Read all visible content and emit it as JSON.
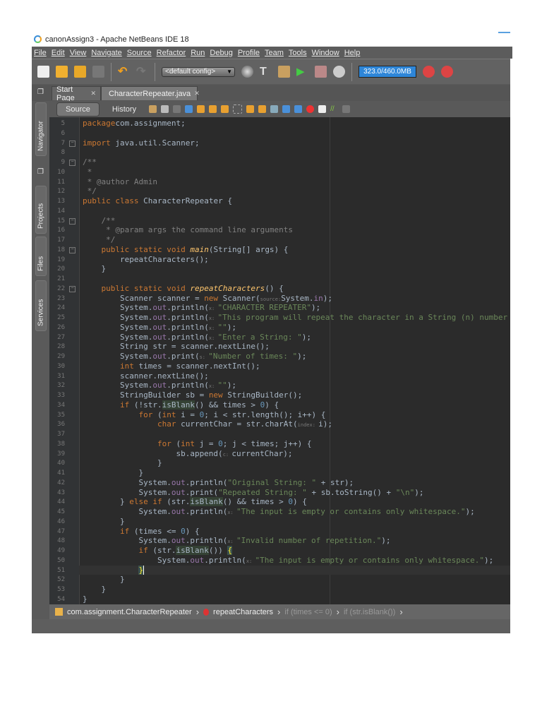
{
  "window": {
    "title": "canonAssign3 - Apache NetBeans IDE 18"
  },
  "menu": [
    "File",
    "Edit",
    "View",
    "Navigate",
    "Source",
    "Refactor",
    "Run",
    "Debug",
    "Profile",
    "Team",
    "Tools",
    "Window",
    "Help"
  ],
  "toolbar": {
    "config": "<default config>",
    "memory": "323.0/460.0MB"
  },
  "tabs": [
    {
      "label": "Start Page"
    },
    {
      "label": "CharacterRepeater.java"
    }
  ],
  "editor_tabs": {
    "source": "Source",
    "history": "History"
  },
  "side_panels": [
    "Navigator",
    "Projects",
    "Files",
    "Services"
  ],
  "breadcrumb": [
    "com.assignment.CharacterRepeater",
    "repeatCharacters",
    "if (times <= 0)",
    "if (str.isBlank())"
  ],
  "code": [
    {
      "n": 5,
      "t": [
        [
          "kw",
          "package"
        ],
        [
          "",
          "com.assignment;"
        ]
      ]
    },
    {
      "n": 6,
      "t": []
    },
    {
      "n": 7,
      "fold": true,
      "t": [
        [
          "kw",
          "import"
        ],
        [
          "",
          " java.util.Scanner;"
        ]
      ]
    },
    {
      "n": 8,
      "t": []
    },
    {
      "n": 9,
      "fold": true,
      "t": [
        [
          "cmt",
          "/**"
        ]
      ]
    },
    {
      "n": 10,
      "t": [
        [
          "cmt",
          " *"
        ]
      ]
    },
    {
      "n": 11,
      "t": [
        [
          "cmt",
          " * @author Admin"
        ]
      ]
    },
    {
      "n": 12,
      "t": [
        [
          "cmt",
          " */"
        ]
      ]
    },
    {
      "n": 13,
      "t": [
        [
          "kw",
          "public class"
        ],
        [
          "",
          " CharacterRepeater {"
        ]
      ]
    },
    {
      "n": 14,
      "t": []
    },
    {
      "n": 15,
      "fold": true,
      "t": [
        [
          "",
          "    "
        ],
        [
          "cmt",
          "/**"
        ]
      ]
    },
    {
      "n": 16,
      "t": [
        [
          "",
          "    "
        ],
        [
          "cmt",
          " * @param args the command line arguments"
        ]
      ]
    },
    {
      "n": 17,
      "t": [
        [
          "",
          "    "
        ],
        [
          "cmt",
          " */"
        ]
      ]
    },
    {
      "n": 18,
      "fold": true,
      "t": [
        [
          "",
          "    "
        ],
        [
          "kw",
          "public static void"
        ],
        [
          "",
          " "
        ],
        [
          "mth",
          "main"
        ],
        [
          "",
          "(String[] args) {"
        ]
      ]
    },
    {
      "n": 19,
      "t": [
        [
          "",
          "        repeatCharacters();"
        ]
      ]
    },
    {
      "n": 20,
      "t": [
        [
          "",
          "    }"
        ]
      ]
    },
    {
      "n": 21,
      "t": []
    },
    {
      "n": 22,
      "fold": true,
      "t": [
        [
          "",
          "    "
        ],
        [
          "kw",
          "public static void"
        ],
        [
          "",
          " "
        ],
        [
          "mth",
          "repeatCharacters"
        ],
        [
          "",
          "() {"
        ]
      ]
    },
    {
      "n": 23,
      "t": [
        [
          "",
          "        Scanner scanner = "
        ],
        [
          "kw",
          "new"
        ],
        [
          "",
          " Scanner("
        ],
        [
          "hint",
          "source:"
        ],
        [
          "",
          "System."
        ],
        [
          "fld",
          "in"
        ],
        [
          "",
          ");"
        ]
      ]
    },
    {
      "n": 24,
      "t": [
        [
          "",
          "        System."
        ],
        [
          "fld",
          "out"
        ],
        [
          "",
          ".println("
        ],
        [
          "hint",
          "x: "
        ],
        [
          "str",
          "\"CHARACTER REPEATER\""
        ],
        [
          "",
          ");"
        ]
      ]
    },
    {
      "n": 25,
      "t": [
        [
          "",
          "        System."
        ],
        [
          "fld",
          "out"
        ],
        [
          "",
          ".println("
        ],
        [
          "hint",
          "x: "
        ],
        [
          "str",
          "\"This program will repeat the character in a String (n) number of times.\""
        ],
        [
          "",
          ");"
        ]
      ]
    },
    {
      "n": 26,
      "t": [
        [
          "",
          "        System."
        ],
        [
          "fld",
          "out"
        ],
        [
          "",
          ".println("
        ],
        [
          "hint",
          "x: "
        ],
        [
          "str",
          "\"\""
        ],
        [
          "",
          ");"
        ]
      ]
    },
    {
      "n": 27,
      "t": [
        [
          "",
          "        System."
        ],
        [
          "fld",
          "out"
        ],
        [
          "",
          ".println("
        ],
        [
          "hint",
          "x: "
        ],
        [
          "str",
          "\"Enter a String: \""
        ],
        [
          "",
          ");"
        ]
      ]
    },
    {
      "n": 28,
      "t": [
        [
          "",
          "        String str = scanner.nextLine();"
        ]
      ]
    },
    {
      "n": 29,
      "t": [
        [
          "",
          "        System."
        ],
        [
          "fld",
          "out"
        ],
        [
          "",
          ".print("
        ],
        [
          "hint",
          "s: "
        ],
        [
          "str",
          "\"Number of times: \""
        ],
        [
          "",
          ");"
        ]
      ]
    },
    {
      "n": 30,
      "t": [
        [
          "",
          "        "
        ],
        [
          "kw",
          "int"
        ],
        [
          "",
          " times = scanner.nextInt();"
        ]
      ]
    },
    {
      "n": 31,
      "t": [
        [
          "",
          "        scanner.nextLine();"
        ]
      ]
    },
    {
      "n": 32,
      "t": [
        [
          "",
          "        System."
        ],
        [
          "fld",
          "out"
        ],
        [
          "",
          ".println("
        ],
        [
          "hint",
          "x: "
        ],
        [
          "str",
          "\"\""
        ],
        [
          "",
          ");"
        ]
      ]
    },
    {
      "n": 33,
      "t": [
        [
          "",
          "        StringBuilder sb = "
        ],
        [
          "kw",
          "new"
        ],
        [
          "",
          " StringBuilder();"
        ]
      ]
    },
    {
      "n": 34,
      "t": [
        [
          "",
          "        "
        ],
        [
          "kw",
          "if"
        ],
        [
          "",
          " (!str."
        ],
        [
          "hl",
          "isBlank"
        ],
        [
          "",
          "() && times > "
        ],
        [
          "num",
          "0"
        ],
        [
          "",
          ") {"
        ]
      ]
    },
    {
      "n": 35,
      "t": [
        [
          "",
          "            "
        ],
        [
          "kw",
          "for"
        ],
        [
          "",
          " ("
        ],
        [
          "kw",
          "int"
        ],
        [
          "",
          " i = "
        ],
        [
          "num",
          "0"
        ],
        [
          "",
          "; i < str.length(); i++) {"
        ]
      ]
    },
    {
      "n": 36,
      "t": [
        [
          "",
          "                "
        ],
        [
          "kw",
          "char"
        ],
        [
          "",
          " currentChar = str.charAt("
        ],
        [
          "hint",
          "index: "
        ],
        [
          "",
          "i);"
        ]
      ]
    },
    {
      "n": 37,
      "t": []
    },
    {
      "n": 38,
      "t": [
        [
          "",
          "                "
        ],
        [
          "kw",
          "for"
        ],
        [
          "",
          " ("
        ],
        [
          "kw",
          "int"
        ],
        [
          "",
          " j = "
        ],
        [
          "num",
          "0"
        ],
        [
          "",
          "; j < times; j++) {"
        ]
      ]
    },
    {
      "n": 39,
      "t": [
        [
          "",
          "                    sb.append("
        ],
        [
          "hint",
          "c: "
        ],
        [
          "",
          "currentChar);"
        ]
      ]
    },
    {
      "n": 40,
      "t": [
        [
          "",
          "                }"
        ]
      ]
    },
    {
      "n": 41,
      "t": [
        [
          "",
          "            }"
        ]
      ]
    },
    {
      "n": 42,
      "t": [
        [
          "",
          "            System."
        ],
        [
          "fld",
          "out"
        ],
        [
          "",
          ".println("
        ],
        [
          "str",
          "\"Original String: \""
        ],
        [
          "",
          " + str);"
        ]
      ]
    },
    {
      "n": 43,
      "t": [
        [
          "",
          "            System."
        ],
        [
          "fld",
          "out"
        ],
        [
          "",
          ".print("
        ],
        [
          "str",
          "\"Repeated String: \""
        ],
        [
          "",
          " + sb.toString() + "
        ],
        [
          "str",
          "\"\\n\""
        ],
        [
          "",
          ");"
        ]
      ]
    },
    {
      "n": 44,
      "t": [
        [
          "",
          "        } "
        ],
        [
          "kw",
          "else if"
        ],
        [
          "",
          " (str."
        ],
        [
          "hl",
          "isBlank"
        ],
        [
          "",
          "() && times > "
        ],
        [
          "num",
          "0"
        ],
        [
          "",
          ") {"
        ]
      ]
    },
    {
      "n": 45,
      "t": [
        [
          "",
          "            System."
        ],
        [
          "fld",
          "out"
        ],
        [
          "",
          ".println("
        ],
        [
          "hint",
          "x: "
        ],
        [
          "str",
          "\"The input is empty or contains only whitespace.\""
        ],
        [
          "",
          ");"
        ]
      ]
    },
    {
      "n": 46,
      "t": [
        [
          "",
          "        }"
        ]
      ]
    },
    {
      "n": 47,
      "t": [
        [
          "",
          "        "
        ],
        [
          "kw",
          "if"
        ],
        [
          "",
          " (times <= "
        ],
        [
          "num",
          "0"
        ],
        [
          "",
          ") {"
        ]
      ]
    },
    {
      "n": 48,
      "t": [
        [
          "",
          "            System."
        ],
        [
          "fld",
          "out"
        ],
        [
          "",
          ".println("
        ],
        [
          "hint",
          "x: "
        ],
        [
          "str",
          "\"Invalid number of repetition.\""
        ],
        [
          "",
          ");"
        ]
      ]
    },
    {
      "n": 49,
      "t": [
        [
          "",
          "            "
        ],
        [
          "kw",
          "if"
        ],
        [
          "",
          " (str."
        ],
        [
          "hl",
          "isBlank"
        ],
        [
          "",
          "()) "
        ],
        [
          "bhl",
          "{"
        ]
      ]
    },
    {
      "n": 50,
      "t": [
        [
          "",
          "                System."
        ],
        [
          "fld",
          "out"
        ],
        [
          "",
          ".println("
        ],
        [
          "hint",
          "x: "
        ],
        [
          "str",
          "\"The input is empty or contains only whitespace.\""
        ],
        [
          "",
          ");"
        ]
      ]
    },
    {
      "n": 51,
      "cur": true,
      "t": [
        [
          "",
          "            "
        ],
        [
          "bhl",
          "}"
        ],
        [
          "caret",
          ""
        ]
      ]
    },
    {
      "n": 52,
      "t": [
        [
          "",
          "        }"
        ]
      ]
    },
    {
      "n": 53,
      "t": [
        [
          "",
          "    }"
        ]
      ]
    },
    {
      "n": 54,
      "t": [
        [
          "",
          "}"
        ]
      ]
    }
  ],
  "colors": {
    "keyword": "#cc7832",
    "string": "#6a8759",
    "comment": "#808080",
    "memory_bar": "#2e86d8"
  }
}
